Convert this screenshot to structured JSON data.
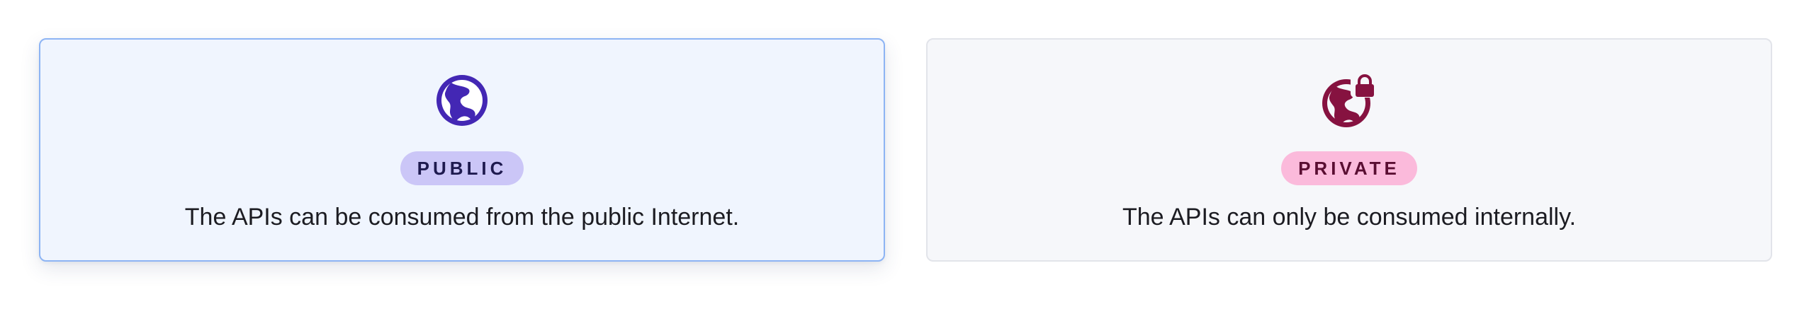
{
  "options": [
    {
      "id": "public",
      "icon": "globe-icon",
      "badge": "PUBLIC",
      "description": "The APIs can be consumed from the public Internet.",
      "selected": true,
      "accent": "#4327b4",
      "badge_bg": "#cbc6f7"
    },
    {
      "id": "private",
      "icon": "globe-lock-icon",
      "badge": "PRIVATE",
      "description": "The APIs can only be consumed internally.",
      "selected": false,
      "accent": "#861240",
      "badge_bg": "#fbbadb"
    }
  ]
}
